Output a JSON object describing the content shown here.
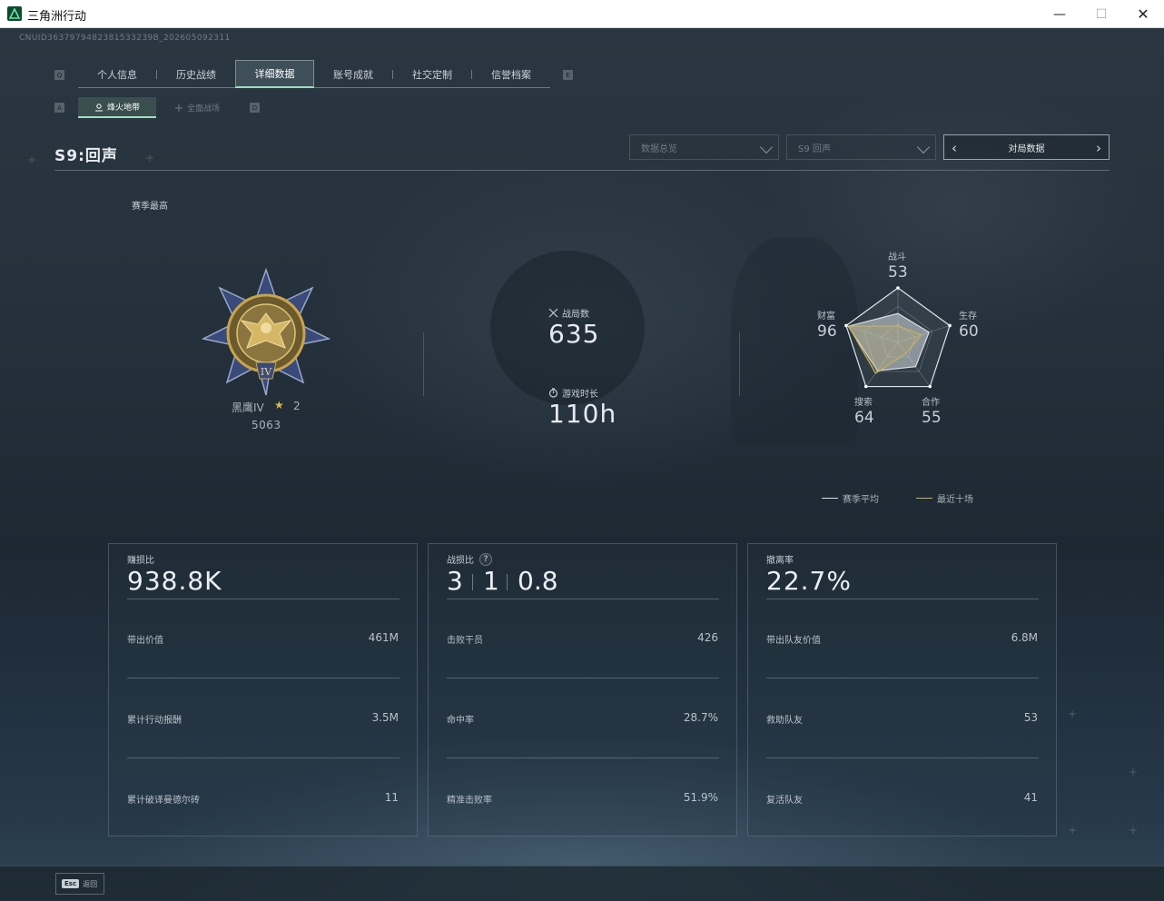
{
  "window": {
    "title": "三角洲行动",
    "min_glyph": "—",
    "max_glyph": "☐",
    "close_glyph": "✕"
  },
  "uid_text": "CNUID3637979482381533239B_202605092311",
  "tabs": {
    "left_key": "Q",
    "right_key": "E",
    "items": [
      {
        "label": "个人信息"
      },
      {
        "label": "历史战绩"
      },
      {
        "label": "详细数据",
        "active": true
      },
      {
        "label": "账号成就"
      },
      {
        "label": "社交定制"
      },
      {
        "label": "信誉档案"
      }
    ]
  },
  "subtabs": {
    "left_key": "A",
    "right_key": "D",
    "active_label": "烽火地带",
    "inactive_label": "全面战场"
  },
  "season": {
    "title": "S9:回声"
  },
  "filters": {
    "data_dropdown": "数据总览",
    "season_dropdown": "S9 回声",
    "pager_label": "对局数据",
    "prev_glyph": "‹",
    "next_glyph": "›"
  },
  "season_best_label": "赛季最高",
  "rank": {
    "name": "黑鹰IV",
    "star_glyph": "★",
    "stars": "2",
    "score": "5063"
  },
  "stats": {
    "matches_label": "战局数",
    "matches_value": "635",
    "playtime_label": "游戏时长",
    "playtime_value": "110h"
  },
  "radar": {
    "axes": [
      {
        "label": "战斗",
        "value": "53"
      },
      {
        "label": "生存",
        "value": "60"
      },
      {
        "label": "合作",
        "value": "55"
      },
      {
        "label": "搜索",
        "value": "64"
      },
      {
        "label": "财富",
        "value": "96"
      }
    ],
    "series": [
      {
        "name": "赛季平均",
        "color": "#d9dee2",
        "values": [
          53,
          60,
          55,
          64,
          96
        ]
      },
      {
        "name": "最近十场",
        "color": "#c9b15a",
        "values": [
          30,
          45,
          25,
          70,
          95
        ]
      }
    ]
  },
  "cards": [
    {
      "title": "赚损比",
      "big": "938.8K",
      "rows": [
        {
          "label": "带出价值",
          "value": "461M"
        },
        {
          "label": "累计行动报酬",
          "value": "3.5M"
        },
        {
          "label": "累计破译曼德尔砖",
          "value": "11"
        }
      ]
    },
    {
      "title": "战损比",
      "kd": [
        "3",
        "1",
        "0.8"
      ],
      "help_glyph": "?",
      "rows": [
        {
          "label": "击败干员",
          "value": "426"
        },
        {
          "label": "命中率",
          "value": "28.7%"
        },
        {
          "label": "精准击败率",
          "value": "51.9%"
        }
      ]
    },
    {
      "title": "撤离率",
      "big": "22.7%",
      "rows": [
        {
          "label": "带出队友价值",
          "value": "6.8M"
        },
        {
          "label": "救助队友",
          "value": "53"
        },
        {
          "label": "复活队友",
          "value": "41"
        }
      ]
    }
  ],
  "footer": {
    "esc_key": "Esc",
    "esc_label": "返回"
  },
  "colors": {
    "accent": "#9fe0bf",
    "gold": "#c9b15a",
    "text": "#cfd6dc"
  }
}
